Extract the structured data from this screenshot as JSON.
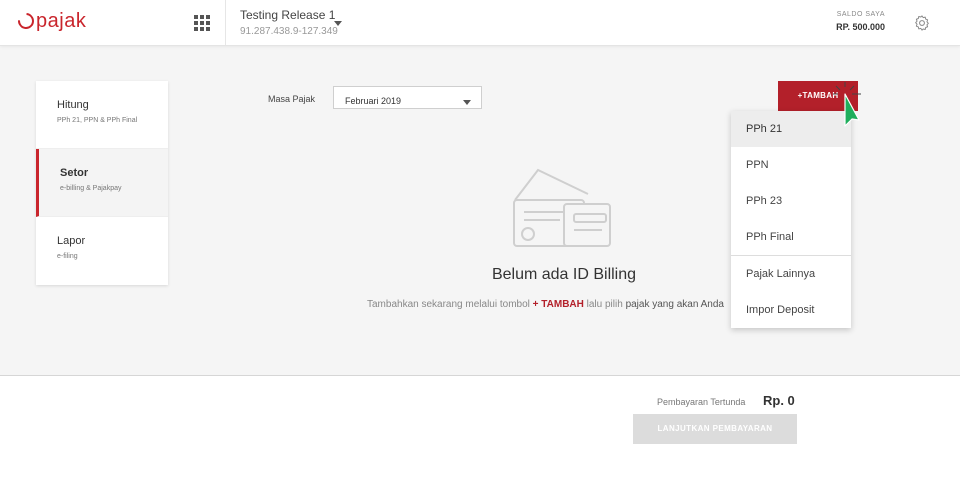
{
  "header": {
    "logo_text": "pajak",
    "company_name": "Testing Release 1",
    "company_npwp": "91.287.438.9-127.349",
    "saldo_label": "SALDO SAYA",
    "saldo_value": "RP. 500.000"
  },
  "sidebar": {
    "items": [
      {
        "title": "Hitung",
        "subtitle": "PPh 21, PPN & PPh Final",
        "active": false
      },
      {
        "title": "Setor",
        "subtitle": "e-billing & Pajakpay",
        "active": true
      },
      {
        "title": "Lapor",
        "subtitle": "e-filing",
        "active": false
      }
    ]
  },
  "filter": {
    "masa_pajak_label": "Masa Pajak",
    "masa_pajak_value": "Februari 2019"
  },
  "tambah_button": "+TAMBAH",
  "empty_state": {
    "title": "Belum ada ID Billing",
    "desc_prefix": "Tambahkan sekarang melalui tombol ",
    "desc_highlight": "+ TAMBAH",
    "desc_middle": " lalu pilih ",
    "desc_dark": "pajak yang akan Anda"
  },
  "dropdown": {
    "items": [
      "PPh 21",
      "PPN",
      "PPh 23",
      "PPh Final",
      "Pajak Lainnya",
      "Impor Deposit"
    ],
    "selected": "PPh 21"
  },
  "footer": {
    "pending_label": "Pembayaran Tertunda",
    "pending_value": "Rp. 0",
    "continue_button": "LANJUTKAN PEMBAYARAN"
  },
  "colors": {
    "brand": "#c9252c",
    "button": "#b3202a",
    "cursor": "#1fae5c"
  },
  "icons": [
    "pajak-logo-icon",
    "apps-grid-icon",
    "chevron-down-icon",
    "gear-icon",
    "billing-card-icon",
    "mouse-cursor-icon"
  ]
}
